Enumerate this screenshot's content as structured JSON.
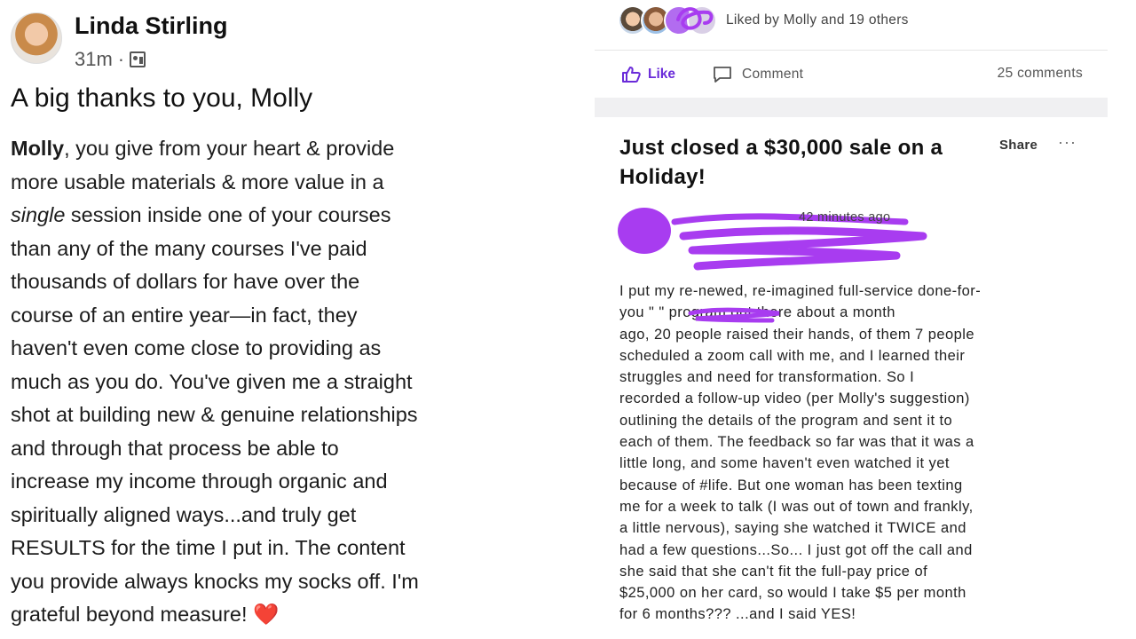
{
  "left_post": {
    "author": "Linda Stirling",
    "time": "31m",
    "separator": "·",
    "visibility_icon": "page-icon",
    "title": "A big thanks to you, Molly",
    "body": {
      "l1_bold": "Molly",
      "l1_rest": ", you give from your heart & provide",
      "l2": "more usable materials & more value in a",
      "l3_italic": "single",
      "l3_rest": " session inside one of your courses",
      "l4": "than any of the many courses I've paid",
      "l5": "thousands of dollars for have over the",
      "l6": "course of an entire year—in fact, they",
      "l7": "haven't even come close to providing as",
      "l8": "much as you do.  You've given me a straight",
      "l9": "shot at building new & genuine relationships",
      "l10": "and through that process be able to",
      "l11": "increase my income through organic and",
      "l12": "spiritually aligned ways...and truly get",
      "l13": "RESULTS for the time I put in. The content",
      "l14": "you provide always knocks my socks off. I'm",
      "l15": "grateful beyond measure!",
      "heart": "❤️"
    }
  },
  "right_post": {
    "liked_by": "Liked by Molly and 19 others",
    "like_label": "Like",
    "comment_label": "Comment",
    "comments_count": "25 comments",
    "title": "Just closed a $30,000 sale on a Holiday!",
    "share_label": "Share",
    "more_label": "···",
    "comment_time": "42 minutes ago",
    "body_lines": [
      "I put my re-newed, re-imagined full-service done-for-",
      "you \"                          \" program out there about a month",
      "ago, 20 people raised their hands, of them 7 people",
      "scheduled a zoom call with me, and I learned their",
      "struggles and need for transformation. So I",
      "recorded a follow-up video (per Molly's suggestion)",
      "outlining the details of the program and sent it to",
      "each of them. The feedback so far was that it was a",
      "little long, and some haven't even watched it yet",
      "because of #life. But one woman has been texting",
      "me for a week to talk (I was out of town and frankly,",
      "a little nervous), saying she watched it TWICE and",
      "had a few questions...So... I just got off the call and",
      "she said that she can't fit the full-pay price of",
      "$25,000 on her card, so would I take $5 per month",
      "for 6 months??? ...and I said YES!"
    ]
  },
  "colors": {
    "accent": "#6a2bd9",
    "redaction": "#a83cf0",
    "heart": "#e0242d"
  }
}
